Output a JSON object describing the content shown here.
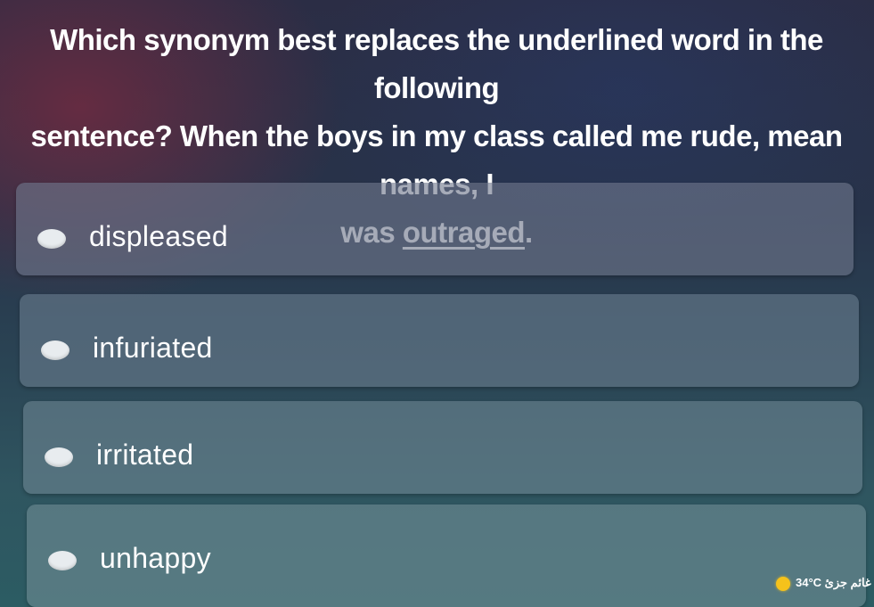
{
  "question": {
    "line1": "Which synonym best replaces the underlined word in the following",
    "line2": "sentence? When the boys in my class called me rude, mean names, I",
    "line3_prefix": "was ",
    "underlined_word": "outraged",
    "line3_suffix": "."
  },
  "options": [
    {
      "label": "displeased"
    },
    {
      "label": "infuriated"
    },
    {
      "label": "irritated"
    },
    {
      "label": "unhappy"
    }
  ],
  "taskbar": {
    "weather_icon": "sun-icon",
    "weather_text": "34°C غائم جزئ",
    "weather_color": "#f5c21b"
  }
}
